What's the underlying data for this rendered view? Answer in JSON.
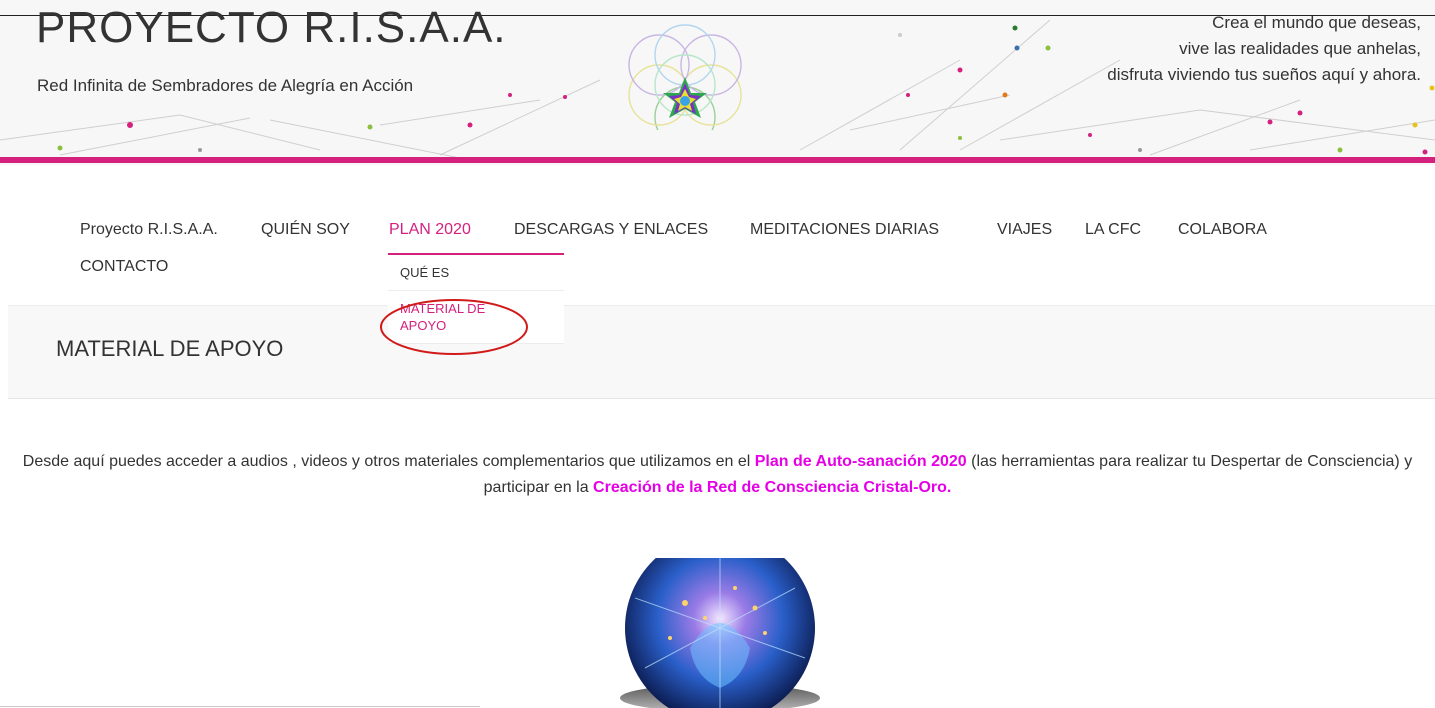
{
  "header": {
    "site_title": "PROYECTO R.I.S.A.A.",
    "tagline": "Red Infinita de Sembradores de Alegría en Acción",
    "slogan": [
      "Crea el mundo que deseas,",
      "vive las realidades que anhelas,",
      "disfruta viviendo tus sueños aquí y ahora."
    ]
  },
  "nav": {
    "items": [
      {
        "label": "Proyecto R.I.S.A.A."
      },
      {
        "label": "QUIÉN SOY"
      },
      {
        "label": "PLAN 2020"
      },
      {
        "label": "DESCARGAS Y ENLACES"
      },
      {
        "label": "MEDITACIONES DIARIAS"
      },
      {
        "label": "VIAJES"
      },
      {
        "label": "LA CFC"
      },
      {
        "label": "COLABORA"
      },
      {
        "label": "CONTACTO"
      }
    ],
    "dropdown": [
      {
        "label": "QUÉ ES"
      },
      {
        "label": "MATERIAL DE APOYO"
      }
    ]
  },
  "page": {
    "title": "MATERIAL DE APOYO",
    "intro_1": "Desde aquí puedes acceder a audios , videos y otros materiales complementarios que utilizamos en el ",
    "link_1": "Plan de Auto-sanación 2020",
    "intro_2": " (las herramientas para realizar tu Despertar de Consciencia) y participar en la ",
    "link_2": "Creación de la Red de Consciencia Cristal-Oro."
  },
  "colors": {
    "accent": "#d4217e",
    "link": "#e600e6",
    "highlight_oval": "#d11a1a"
  }
}
